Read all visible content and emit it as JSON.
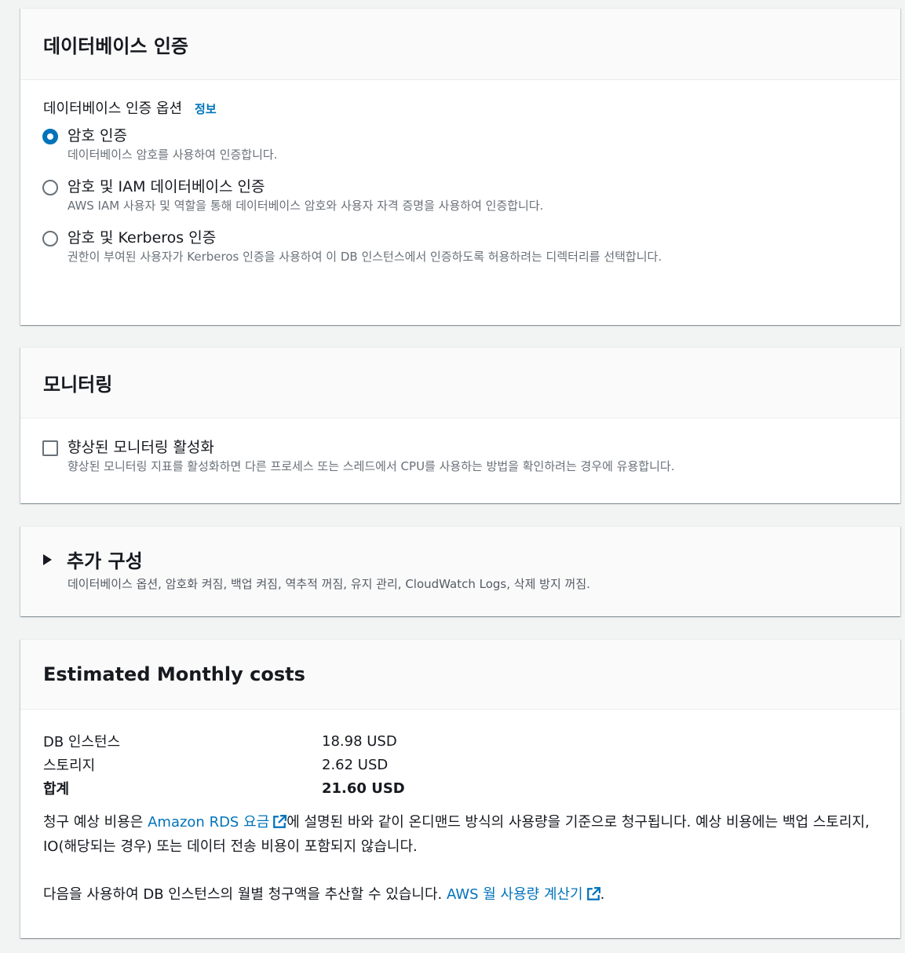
{
  "auth": {
    "title": "데이터베이스 인증",
    "field_label": "데이터베이스 인증 옵션",
    "info_link": "정보",
    "options": [
      {
        "label": "암호 인증",
        "desc": "데이터베이스 암호를 사용하여 인증합니다.",
        "selected": true
      },
      {
        "label": "암호 및 IAM 데이터베이스 인증",
        "desc": "AWS IAM 사용자 및 역할을 통해 데이터베이스 암호와 사용자 자격 증명을 사용하여 인증합니다.",
        "selected": false
      },
      {
        "label": "암호 및 Kerberos 인증",
        "desc": "권한이 부여된 사용자가 Kerberos 인증을 사용하여 이 DB 인스턴스에서 인증하도록 허용하려는 디렉터리를 선택합니다.",
        "selected": false
      }
    ]
  },
  "monitoring": {
    "title": "모니터링",
    "checkbox_label": "향상된 모니터링 활성화",
    "checkbox_desc": "향상된 모니터링 지표를 활성화하면 다른 프로세스 또는 스레드에서 CPU를 사용하는 방법을 확인하려는 경우에 유용합니다.",
    "checked": false
  },
  "additional": {
    "title": "추가 구성",
    "desc": "데이터베이스 옵션, 암호화 켜짐, 백업 켜짐, 역추적 꺼짐, 유지 관리, CloudWatch Logs, 삭제 방지 꺼짐."
  },
  "costs": {
    "title": "Estimated Monthly costs",
    "rows": [
      {
        "label": "DB 인스턴스",
        "value": "18.98 USD"
      },
      {
        "label": "스토리지",
        "value": "2.62 USD"
      },
      {
        "label": "합계",
        "value": "21.60 USD"
      }
    ],
    "para1_before": "청구 예상 비용은 ",
    "para1_link": "Amazon RDS 요금",
    "para1_after": "에 설명된 바와 같이 온디맨드 방식의 사용량을 기준으로 청구됩니다. 예상 비용에는 백업 스토리지, IO(해당되는 경우) 또는 데이터 전송 비용이 포함되지 않습니다.",
    "para2_before": "다음을 사용하여 DB 인스턴스의 월별 청구액을 추산할 수 있습니다. ",
    "para2_link": "AWS 월 사용량 계산기",
    "para2_after": "."
  },
  "colors": {
    "link": "#0073bb",
    "radio_selected": "#0073bb",
    "muted_text": "#687078"
  },
  "icons": {
    "external": "external-link-icon",
    "caret": "caret-right-icon"
  }
}
